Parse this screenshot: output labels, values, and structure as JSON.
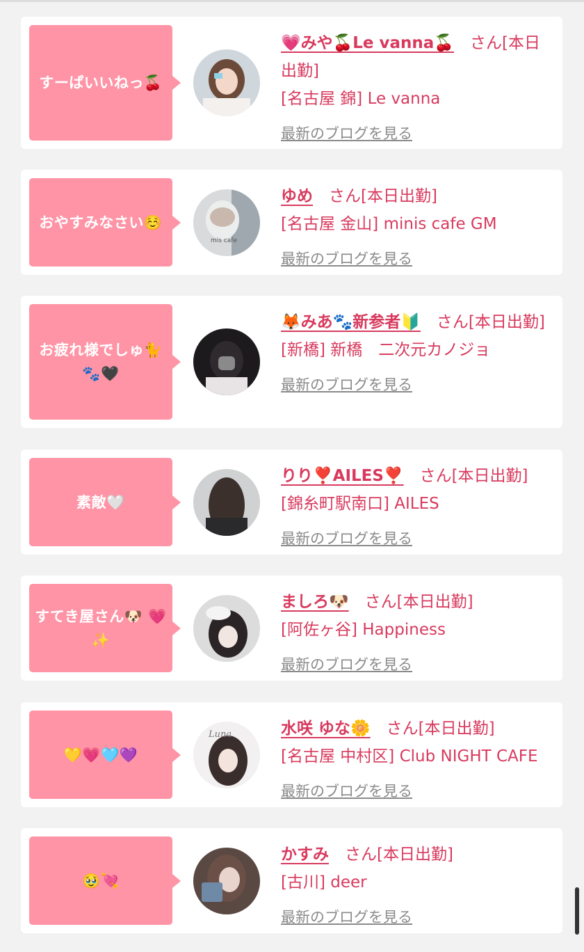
{
  "blog_link_label": "最新のブログを見る",
  "items": [
    {
      "comment": "すーぱいいねっ🍒",
      "name": "💗みや🍒Le vanna🍒",
      "suffix": "さん[本日出勤]",
      "shop": "[名古屋 錦] Le vanna"
    },
    {
      "comment": "おやすみなさい☺️",
      "name": "ゆめ",
      "suffix": "さん[本日出勤]",
      "shop": "[名古屋 金山] minis cafe GM",
      "avatar_caption": "mis cafe"
    },
    {
      "comment": "お疲れ様でしゅ🐈 🐾🖤",
      "name": "🦊みあ🐾新参者🔰",
      "suffix": "さん[本日出勤]",
      "shop": "[新橋] 新橋　二次元カノジョ"
    },
    {
      "comment": "素敵🤍",
      "name": "りり❣️AILES❣️",
      "suffix": "さん[本日出勤]",
      "shop": "[錦糸町駅南口] AILES"
    },
    {
      "comment": "すてき屋さん🐶 💗✨",
      "name": "ましろ🐶",
      "suffix": "さん[本日出勤]",
      "shop": "[阿佐ヶ谷] Happiness"
    },
    {
      "comment": "💛💗🩵💜",
      "name": "水咲 ゆな🌼",
      "suffix": "さん[本日出勤]",
      "shop": "[名古屋 中村区] Club NIGHT CAFE",
      "avatar_caption": "Luna"
    },
    {
      "comment": "🥹💘",
      "name": "かすみ",
      "suffix": "さん[本日出勤]",
      "shop": "[古川] deer"
    }
  ]
}
